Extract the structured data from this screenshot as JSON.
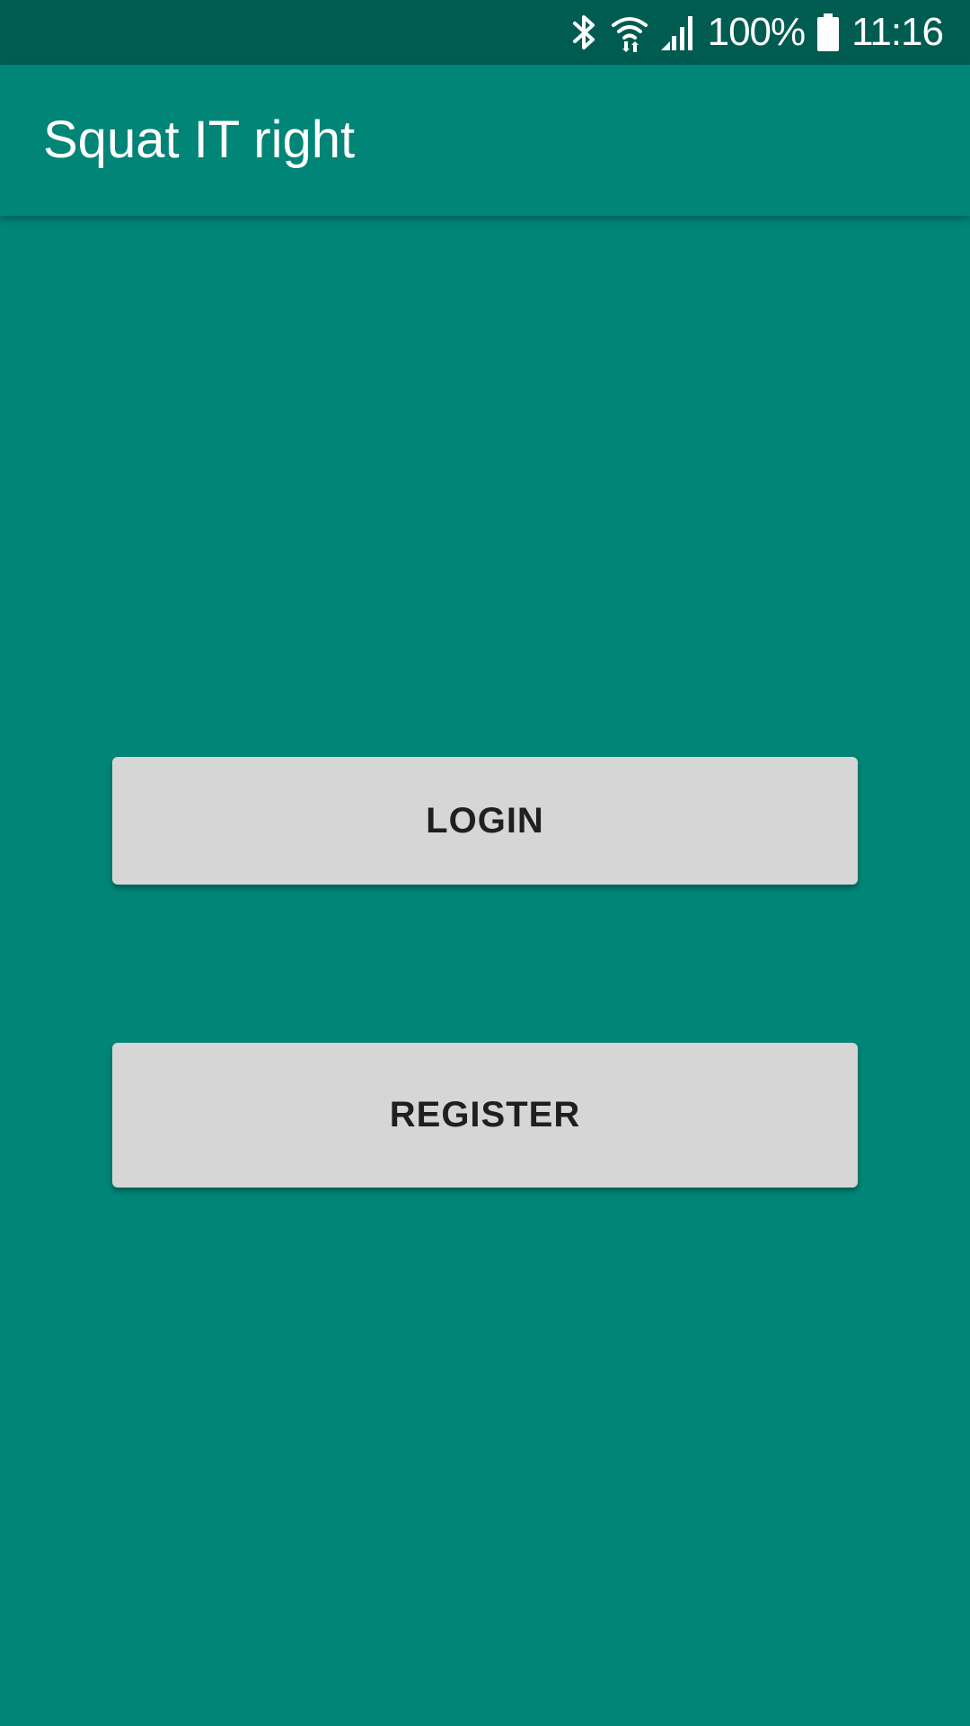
{
  "status_bar": {
    "battery_percent": "100%",
    "time": "11:16",
    "icons": [
      "bluetooth-icon",
      "wifi-icon",
      "signal-icon",
      "battery-icon"
    ]
  },
  "app_bar": {
    "title": "Squat IT right"
  },
  "buttons": {
    "login_label": "LOGIN",
    "register_label": "REGISTER"
  },
  "colors": {
    "primary": "#018577",
    "primary_dark": "#005c51",
    "button_bg": "#d6d6d6",
    "button_text": "#1f1f1f"
  }
}
